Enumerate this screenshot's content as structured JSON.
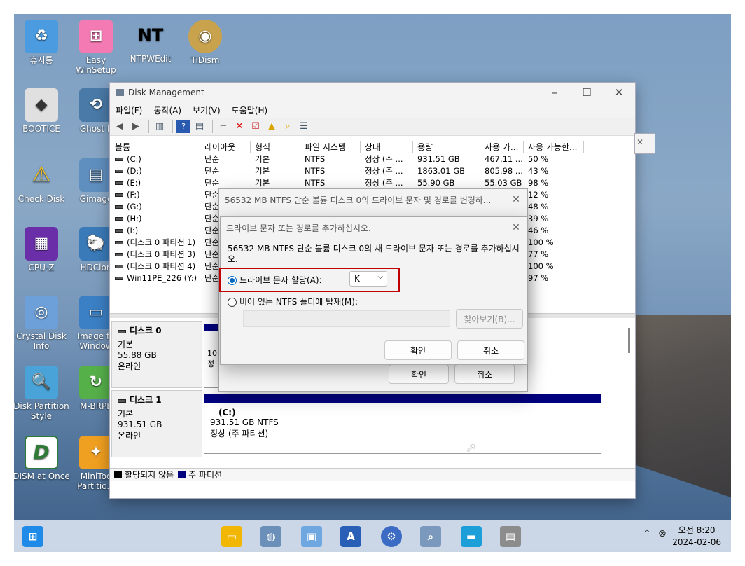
{
  "desktop_icons": [
    {
      "label": "휴지통",
      "icon": "recycle-bin-icon",
      "color": "#4a9be0"
    },
    {
      "label": "Easy WinSetup",
      "icon": "windows-logo-icon",
      "color": "#f37ab2"
    },
    {
      "label": "NTPWEdit",
      "icon": "ntpwedit-icon",
      "color": "#d0141a"
    },
    {
      "label": "TiDism",
      "icon": "tidism-icon",
      "color": "#c8a24d"
    },
    {
      "label": "BOOTICE",
      "icon": "bootice-icon",
      "color": "#e0e0e0"
    },
    {
      "label": "Ghost P",
      "icon": "ghost-icon",
      "color": "#4a7aa8"
    },
    {
      "label": "Check Disk",
      "icon": "check-disk-icon",
      "color": "#f2c21b"
    },
    {
      "label": "Gimage",
      "icon": "gimage-icon",
      "color": "#5f8fbf"
    },
    {
      "label": "CPU-Z",
      "icon": "cpu-z-icon",
      "color": "#6a2fa8"
    },
    {
      "label": "HDClon",
      "icon": "hdclone-icon",
      "color": "#3a7ab8"
    },
    {
      "label": "Crystal Disk Info",
      "icon": "crystal-disk-info-icon",
      "color": "#6da0d8"
    },
    {
      "label": "Image fo Window",
      "icon": "image-for-windows-icon",
      "color": "#3b7fc4"
    },
    {
      "label": "Disk Partition Style",
      "icon": "disk-partition-style-icon",
      "color": "#4aa3d8"
    },
    {
      "label": "M-BRPE",
      "icon": "m-brpe-icon",
      "color": "#56b04a"
    },
    {
      "label": "DISM at Once",
      "icon": "dism-at-once-icon",
      "color": "#2f7a36"
    },
    {
      "label": "MiniToo Partitio...",
      "icon": "minitool-partition-icon",
      "color": "#f0a020"
    }
  ],
  "disk_management": {
    "title": "Disk Management",
    "menu": [
      "파일(F)",
      "동작(A)",
      "보기(V)",
      "도움말(H)"
    ],
    "columns": [
      "볼륨",
      "레이아웃",
      "형식",
      "파일 시스템",
      "상태",
      "용량",
      "사용 가...",
      "사용 가능한..."
    ],
    "volumes": [
      {
        "name": "(C:)",
        "layout": "단순",
        "type": "기본",
        "fs": "NTFS",
        "status": "정상 (주 ...",
        "capacity": "931.51 GB",
        "free": "467.11 ...",
        "pct": "50 %"
      },
      {
        "name": "(D:)",
        "layout": "단순",
        "type": "기본",
        "fs": "NTFS",
        "status": "정상 (주 ...",
        "capacity": "1863.01 GB",
        "free": "805.98 ...",
        "pct": "43 %"
      },
      {
        "name": "(E:)",
        "layout": "단순",
        "type": "기본",
        "fs": "NTFS",
        "status": "정상 (주 ...",
        "capacity": "55.90 GB",
        "free": "55.03 GB",
        "pct": "98 %"
      },
      {
        "name": "(F:)",
        "layout": "단순",
        "type": "",
        "fs": "",
        "status": "",
        "capacity": "",
        "free": "",
        "pct": "12 %"
      },
      {
        "name": "(G:)",
        "layout": "단순",
        "type": "",
        "fs": "",
        "status": "",
        "capacity": "",
        "free": "",
        "pct": "48 %"
      },
      {
        "name": "(H:)",
        "layout": "단순",
        "type": "",
        "fs": "",
        "status": "",
        "capacity": "",
        "free": "",
        "pct": "39 %"
      },
      {
        "name": "(I:)",
        "layout": "단순",
        "type": "",
        "fs": "",
        "status": "",
        "capacity": "",
        "free": "",
        "pct": "46 %"
      },
      {
        "name": "(디스크 0 파티션 1)",
        "layout": "단순",
        "type": "",
        "fs": "",
        "status": "",
        "capacity": "",
        "free": "",
        "pct": "100 %"
      },
      {
        "name": "(디스크 0 파티션 3)",
        "layout": "단순",
        "type": "",
        "fs": "",
        "status": "",
        "capacity": "",
        "free": "",
        "pct": "77 %"
      },
      {
        "name": "(디스크 0 파티션 4)",
        "layout": "단순",
        "type": "",
        "fs": "",
        "status": "",
        "capacity": "",
        "free": "",
        "pct": "100 %"
      },
      {
        "name": "Win11PE_226 (Y:)",
        "layout": "단순",
        "type": "",
        "fs": "",
        "status": "",
        "capacity": "",
        "free": "",
        "pct": "97 %"
      }
    ],
    "disk0": {
      "name": "디스크 0",
      "kind": "기본",
      "size": "55.88 GB",
      "state": "온라인",
      "part_cut1": "10",
      "part_cut2": "정"
    },
    "disk1": {
      "name": "디스크 1",
      "kind": "기본",
      "size": "931.51 GB",
      "state": "온라인",
      "partition": {
        "label": "(C:)",
        "size": "931.51 GB NTFS",
        "status": "정상 (주 파티션)"
      }
    },
    "legend": {
      "unallocated": "할당되지 않음",
      "primary": "주 파티션"
    }
  },
  "change_dialog": {
    "title": "56532 MB NTFS 단순 볼륨 디스크 0의 드라이브 문자 및 경로를 변경하...",
    "ok": "확인",
    "cancel": "취소"
  },
  "add_dialog": {
    "title": "드라이브 문자 또는 경로를 추가하십시오.",
    "description": "56532 MB NTFS 단순 볼륨 디스크 0의 새 드라이브 문자 또는 경로를 추가하십시오.",
    "option_assign": "드라이브 문자 할당(A):",
    "drive_letter": "K",
    "option_mount": "비어 있는 NTFS 폴더에 탑재(M):",
    "browse": "찾아보기(B)...",
    "ok": "확인",
    "cancel": "취소"
  },
  "taskbar": {
    "clock_time": "오전 8:20",
    "clock_date": "2024-02-06"
  },
  "colors": {
    "primary_partition": "#00007f",
    "highlight_box": "#c00000",
    "accent": "#0067c0"
  }
}
